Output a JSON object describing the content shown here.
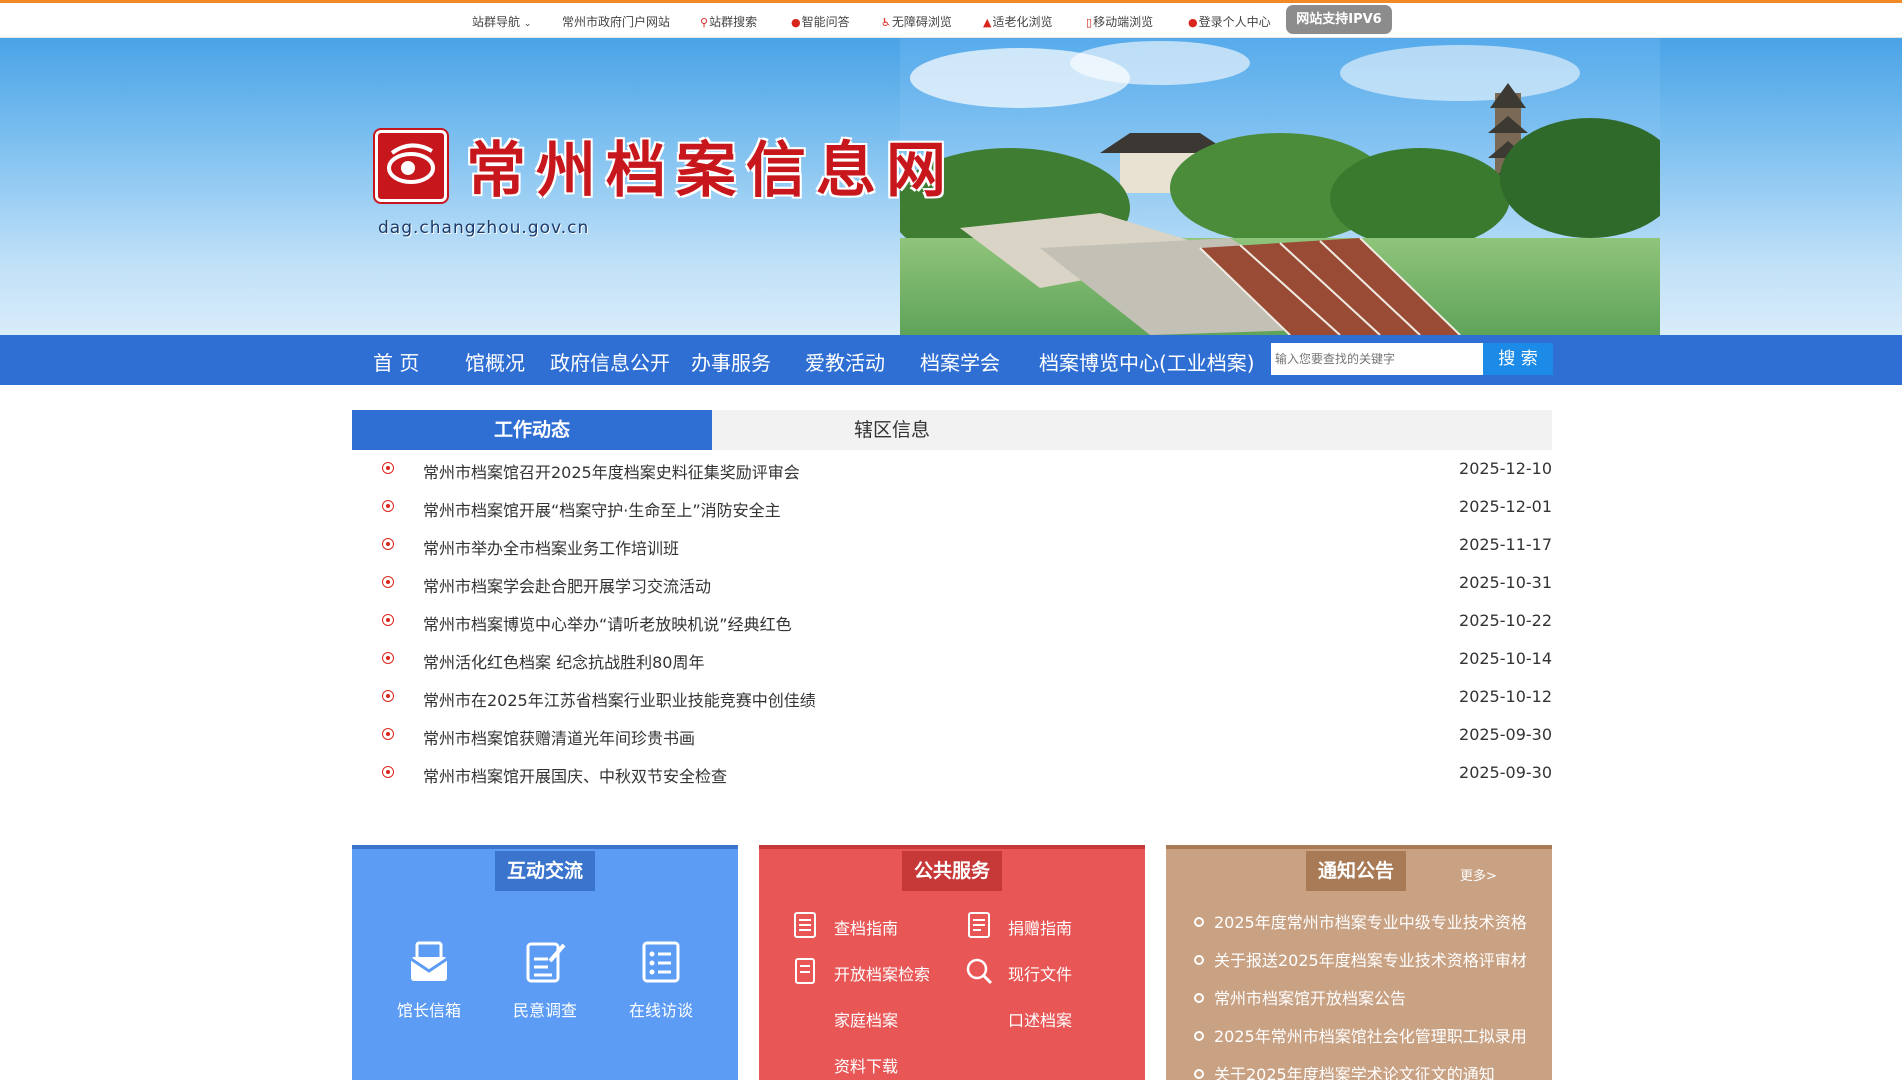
{
  "topbar": {
    "items": [
      "站群导航",
      "常州市政府门户网站",
      "站群搜索",
      "智能问答",
      "无障碍浏览",
      "适老化浏览",
      "移动端浏览",
      "登录个人中心"
    ],
    "ipv6": "网站支持IPV6"
  },
  "banner": {
    "site_title": "常州档案信息网",
    "url": "dag.changzhou.gov.cn"
  },
  "nav": {
    "items": [
      "首 页",
      "馆概况",
      "政府信息公开",
      "办事服务",
      "爱教活动",
      "档案学会",
      "档案博览中心(工业档案)"
    ],
    "search_placeholder": "输入您要查找的关键字",
    "search_button": "搜 索"
  },
  "tabs": {
    "active": "工作动态",
    "other": "辖区信息"
  },
  "news": [
    {
      "title": "常州市档案馆召开2025年度档案史料征集奖励评审会",
      "date": "2025-12-10"
    },
    {
      "title": "常州市档案馆开展“档案守护·生命至上”消防安全主",
      "date": "2025-12-01"
    },
    {
      "title": "常州市举办全市档案业务工作培训班",
      "date": "2025-11-17"
    },
    {
      "title": "常州市档案学会赴合肥开展学习交流活动",
      "date": "2025-10-31"
    },
    {
      "title": "常州市档案博览中心举办“请听老放映机说”经典红色",
      "date": "2025-10-22"
    },
    {
      "title": "常州活化红色档案 纪念抗战胜利80周年",
      "date": "2025-10-14"
    },
    {
      "title": "常州市在2025年江苏省档案行业职业技能竞赛中创佳绩",
      "date": "2025-10-12"
    },
    {
      "title": "常州市档案馆获赠清道光年间珍贵书画",
      "date": "2025-09-30"
    },
    {
      "title": "常州市档案馆开展国庆、中秋双节安全检查",
      "date": "2025-09-30"
    }
  ],
  "interaction": {
    "title": "互动交流",
    "items": [
      "馆长信箱",
      "民意调查",
      "在线访谈"
    ]
  },
  "public_service": {
    "title": "公共服务",
    "items": [
      "查档指南",
      "捐赠指南",
      "开放档案检索",
      "现行文件",
      "家庭档案",
      "口述档案",
      "资料下载"
    ]
  },
  "notices": {
    "title": "通知公告",
    "more": "更多>",
    "items": [
      "2025年度常州市档案专业中级专业技术资格",
      "关于报送2025年度档案专业技术资格评审材",
      "常州市档案馆开放档案公告",
      "2025年常州市档案馆社会化管理职工拟录用",
      "关于2025年度档案学术论文征文的通知"
    ]
  },
  "colors": {
    "nav_blue": "#2f6fd4",
    "accent_orange": "#f08a24",
    "logo_red": "#c8161d",
    "box_blue": "#5c9cf5",
    "box_red": "#e95656",
    "box_tan": "#c9a183"
  }
}
